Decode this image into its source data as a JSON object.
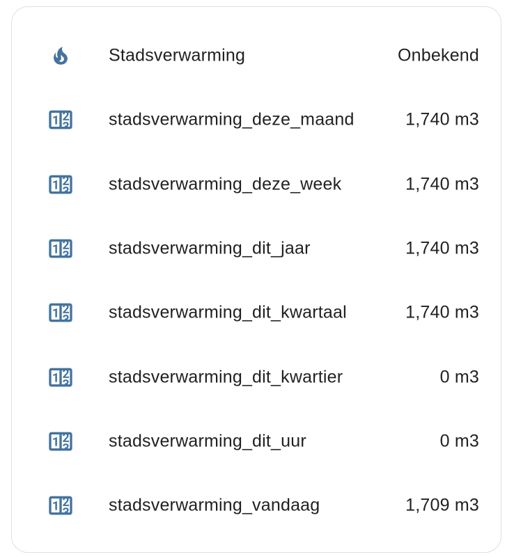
{
  "colors": {
    "icon": "#44739e",
    "text": "#212121",
    "card_border": "#e0e0e0",
    "background": "#ffffff"
  },
  "entities": [
    {
      "icon": "fire-icon",
      "name": "Stadsverwarming",
      "state": "Onbekend"
    },
    {
      "icon": "counter-icon",
      "name": "stadsverwarming_deze_maand",
      "state": "1,740 m3"
    },
    {
      "icon": "counter-icon",
      "name": "stadsverwarming_deze_week",
      "state": "1,740 m3"
    },
    {
      "icon": "counter-icon",
      "name": "stadsverwarming_dit_jaar",
      "state": "1,740 m3"
    },
    {
      "icon": "counter-icon",
      "name": "stadsverwarming_dit_kwartaal",
      "state": "1,740 m3"
    },
    {
      "icon": "counter-icon",
      "name": "stadsverwarming_dit_kwartier",
      "state": "0 m3"
    },
    {
      "icon": "counter-icon",
      "name": "stadsverwarming_dit_uur",
      "state": "0 m3"
    },
    {
      "icon": "counter-icon",
      "name": "stadsverwarming_vandaag",
      "state": "1,709 m3"
    }
  ]
}
